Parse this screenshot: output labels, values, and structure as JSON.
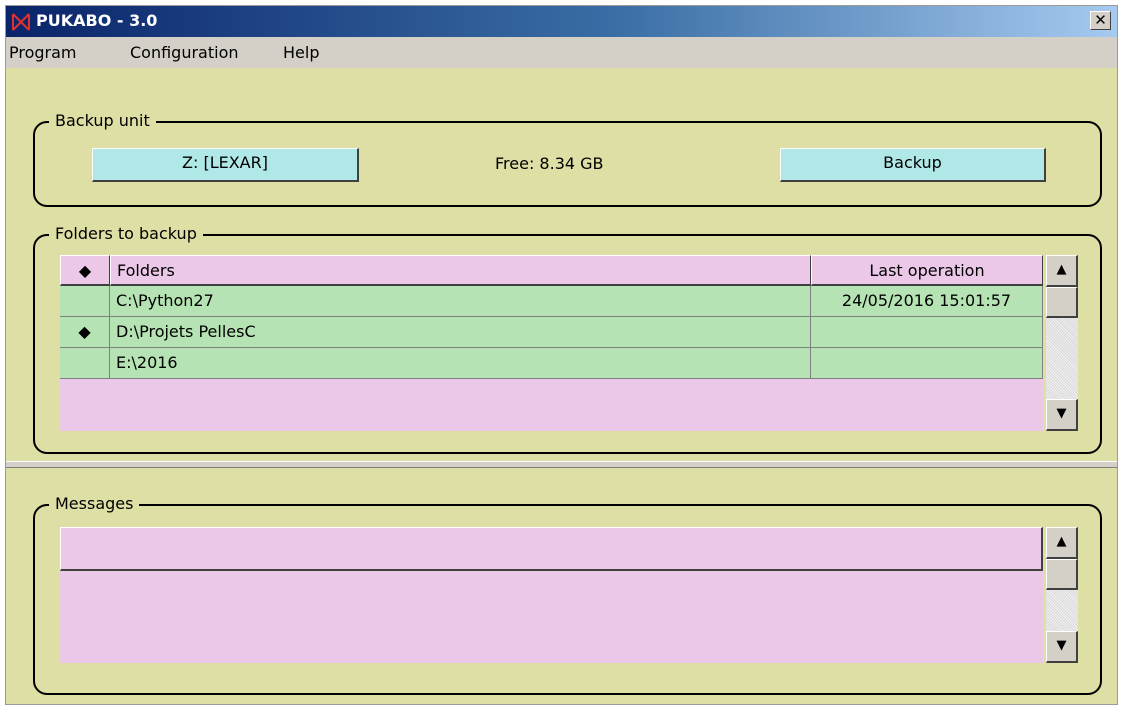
{
  "window": {
    "title": "PUKABO - 3.0",
    "close_label": "✕"
  },
  "menu": [
    "Program",
    "Configuration",
    "Help"
  ],
  "backup_unit": {
    "legend": "Backup unit",
    "drive_button": "Z: [LEXAR]",
    "free_space": "Free: 8.34 GB",
    "backup_button": "Backup"
  },
  "folders": {
    "legend": "Folders to backup",
    "header_marker": "◆",
    "columns": [
      "Folders",
      "Last operation"
    ],
    "rows": [
      {
        "marker": "",
        "folder": "C:\\Python27",
        "last_operation": "24/05/2016 15:01:57"
      },
      {
        "marker": "◆",
        "folder": "D:\\Projets PellesC",
        "last_operation": ""
      },
      {
        "marker": "",
        "folder": "E:\\2016",
        "last_operation": ""
      }
    ]
  },
  "messages": {
    "legend": "Messages"
  },
  "colors": {
    "panel_bg": "#dedfa5",
    "pink": "#ebc8e8",
    "green": "#b5e3b3",
    "cyan_button": "#b0e8e8"
  }
}
